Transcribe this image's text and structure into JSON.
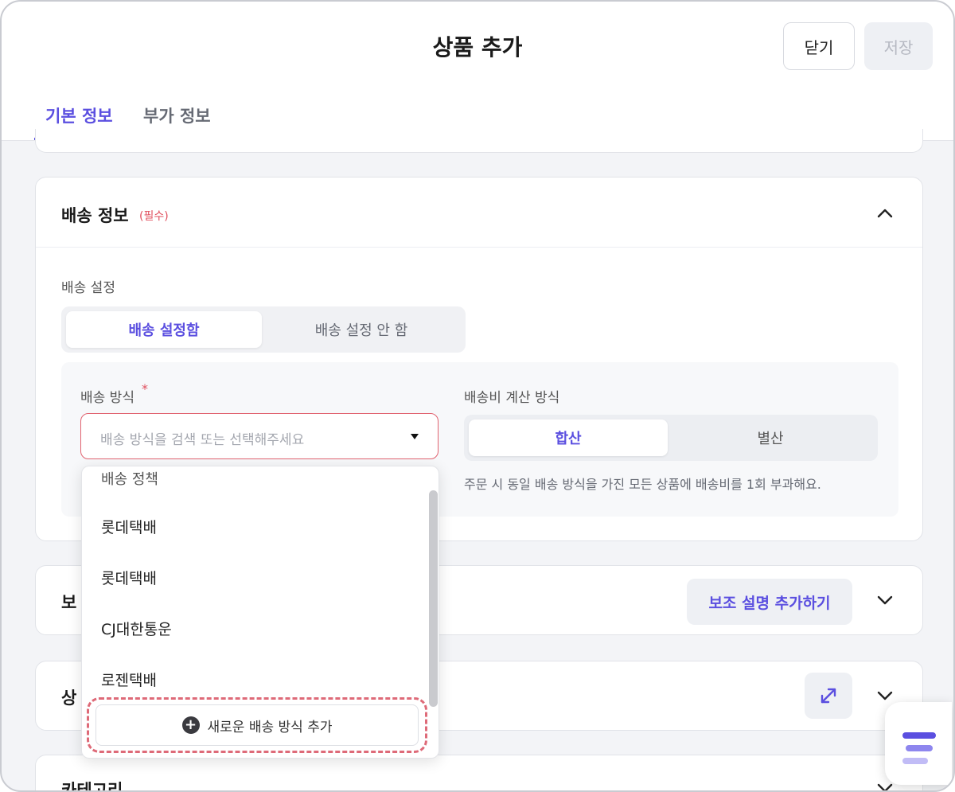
{
  "header": {
    "title": "상품 추가",
    "close_label": "닫기",
    "save_label": "저장"
  },
  "tabs": [
    {
      "label": "기본 정보",
      "active": true
    },
    {
      "label": "부가 정보",
      "active": false
    }
  ],
  "delivery": {
    "title": "배송 정보",
    "required_tag": "(필수)",
    "setting_label": "배송 설정",
    "setting_options": [
      "배송 설정함",
      "배송 설정 안 함"
    ],
    "setting_selected": "배송 설정함",
    "method_label": "배송 방식",
    "method_required_mark": "*",
    "method_placeholder": "배송 방식을 검색 또는 선택해주세요",
    "fee_label": "배송비 계산 방식",
    "fee_options": [
      "합산",
      "별산"
    ],
    "fee_selected": "합산",
    "fee_description": "주문 시 동일 배송 방식을 가진 모든 상품에 배송비를 1회 부과해요."
  },
  "dropdown": {
    "group_label": "배송 정책",
    "items": [
      "롯데택배",
      "롯데택배",
      "CJ대한통운",
      "로젠택배"
    ],
    "add_label": "새로운 배송 방식 추가"
  },
  "sections": {
    "sub_title_partial": "보",
    "sub_button": "보조 설명 추가하기",
    "product_title_partial": "상",
    "category_title": "카테고리"
  },
  "colors": {
    "accent": "#5b4fe0",
    "required": "#e0505e",
    "highlight_dash": "#de6a78"
  },
  "icons": {
    "collapse": "chevron-up-icon",
    "expand": "chevron-down-icon",
    "fullscreen": "expand-arrows-icon",
    "add": "plus-circle-icon",
    "menu": "menu-icon"
  }
}
